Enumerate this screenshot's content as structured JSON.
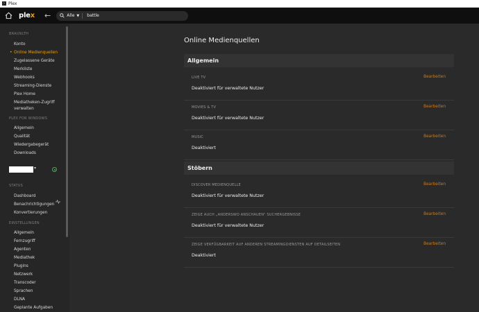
{
  "window": {
    "title": "Plex",
    "icon": "plex-app-icon"
  },
  "topbar": {
    "logo_main": "ple",
    "logo_accent": "x",
    "search": {
      "scope": "Alle",
      "query": "battle"
    }
  },
  "sidebar": {
    "sections": {
      "browser": "BRAUNLTH",
      "plex_windows": "PLEX FOR WINDOWS",
      "status": "STATUS",
      "settings": "EINSTELLUNGEN"
    },
    "account_items": [
      "Konto",
      "Online Medienquellen",
      "Zugelassene Geräte",
      "Merkliste",
      "Webhooks",
      "Streaming-Dienste",
      "Plex Home",
      "Mediatheken-Zugriff",
      "verwalten"
    ],
    "windows_items": [
      "Allgemein",
      "Qualität",
      "Wiedergabegerät",
      "Downloads"
    ],
    "status_items": [
      "Dashboard",
      "Benachrichtigungen",
      "Konvertierungen"
    ],
    "settings_items": [
      "Allgemein",
      "Fernzugriff",
      "Agenten",
      "Mediathek",
      "Plugins",
      "Netzwerk",
      "Transcoder",
      "Sprachen",
      "DLNA",
      "Geplante Aufgaben"
    ]
  },
  "main": {
    "title": "Online Medienquellen",
    "edit_label": "Bearbeiten",
    "groups": [
      {
        "header": "Allgemein",
        "rows": [
          {
            "label": "LIVE TV",
            "value": "Deaktiviert für verwaltete Nutzer"
          },
          {
            "label": "MOVIES & TV",
            "value": "Deaktiviert für verwaltete Nutzer"
          },
          {
            "label": "MUSIC",
            "value": "Deaktiviert"
          }
        ]
      },
      {
        "header": "Stöbern",
        "rows": [
          {
            "label": "DISCOVER MEDIENQUELLE",
            "value": "Deaktiviert für verwaltete Nutzer"
          },
          {
            "label": "ZEIGE AUCH „ANDERSWO ANSCHAUEN\" SUCHERGEBNISSE",
            "value": "Deaktiviert für verwaltete Nutzer"
          },
          {
            "label": "ZEIGE VERFÜGBARKEIT AUF ANDEREN STREAMINGDIENSTEN AUF DETAILSEITEN",
            "value": "Deaktiviert"
          }
        ]
      }
    ]
  },
  "colors": {
    "accent": "#e5a00d",
    "edit_link": "#cc7b19",
    "status_ok": "#4caf50"
  }
}
